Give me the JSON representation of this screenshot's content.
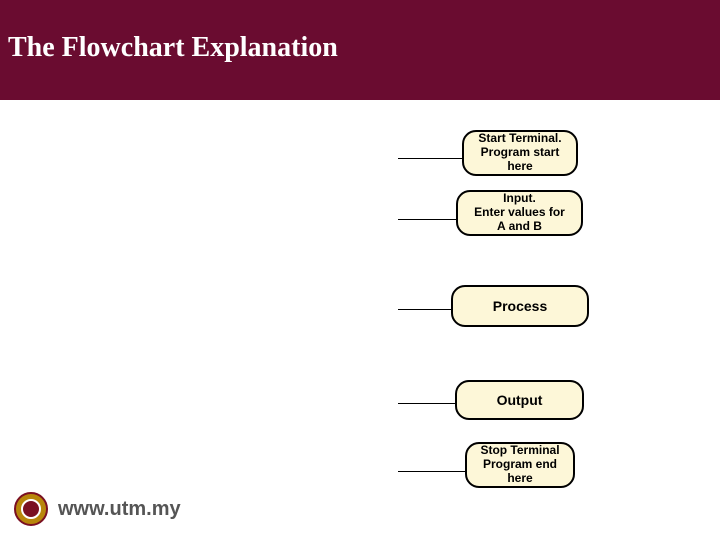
{
  "title": "The Flowchart Explanation",
  "footer": {
    "site": "www.utm.my"
  },
  "boxes": {
    "start": {
      "l1": "Start Terminal.",
      "l2": "Program start",
      "l3": "here"
    },
    "input": {
      "l1": "Input.",
      "l2": "Enter values for",
      "l3": "A and B"
    },
    "process": {
      "l1": "Process"
    },
    "output": {
      "l1": "Output"
    },
    "stop": {
      "l1": "Stop Terminal",
      "l2": "Program end",
      "l3": "here"
    }
  }
}
